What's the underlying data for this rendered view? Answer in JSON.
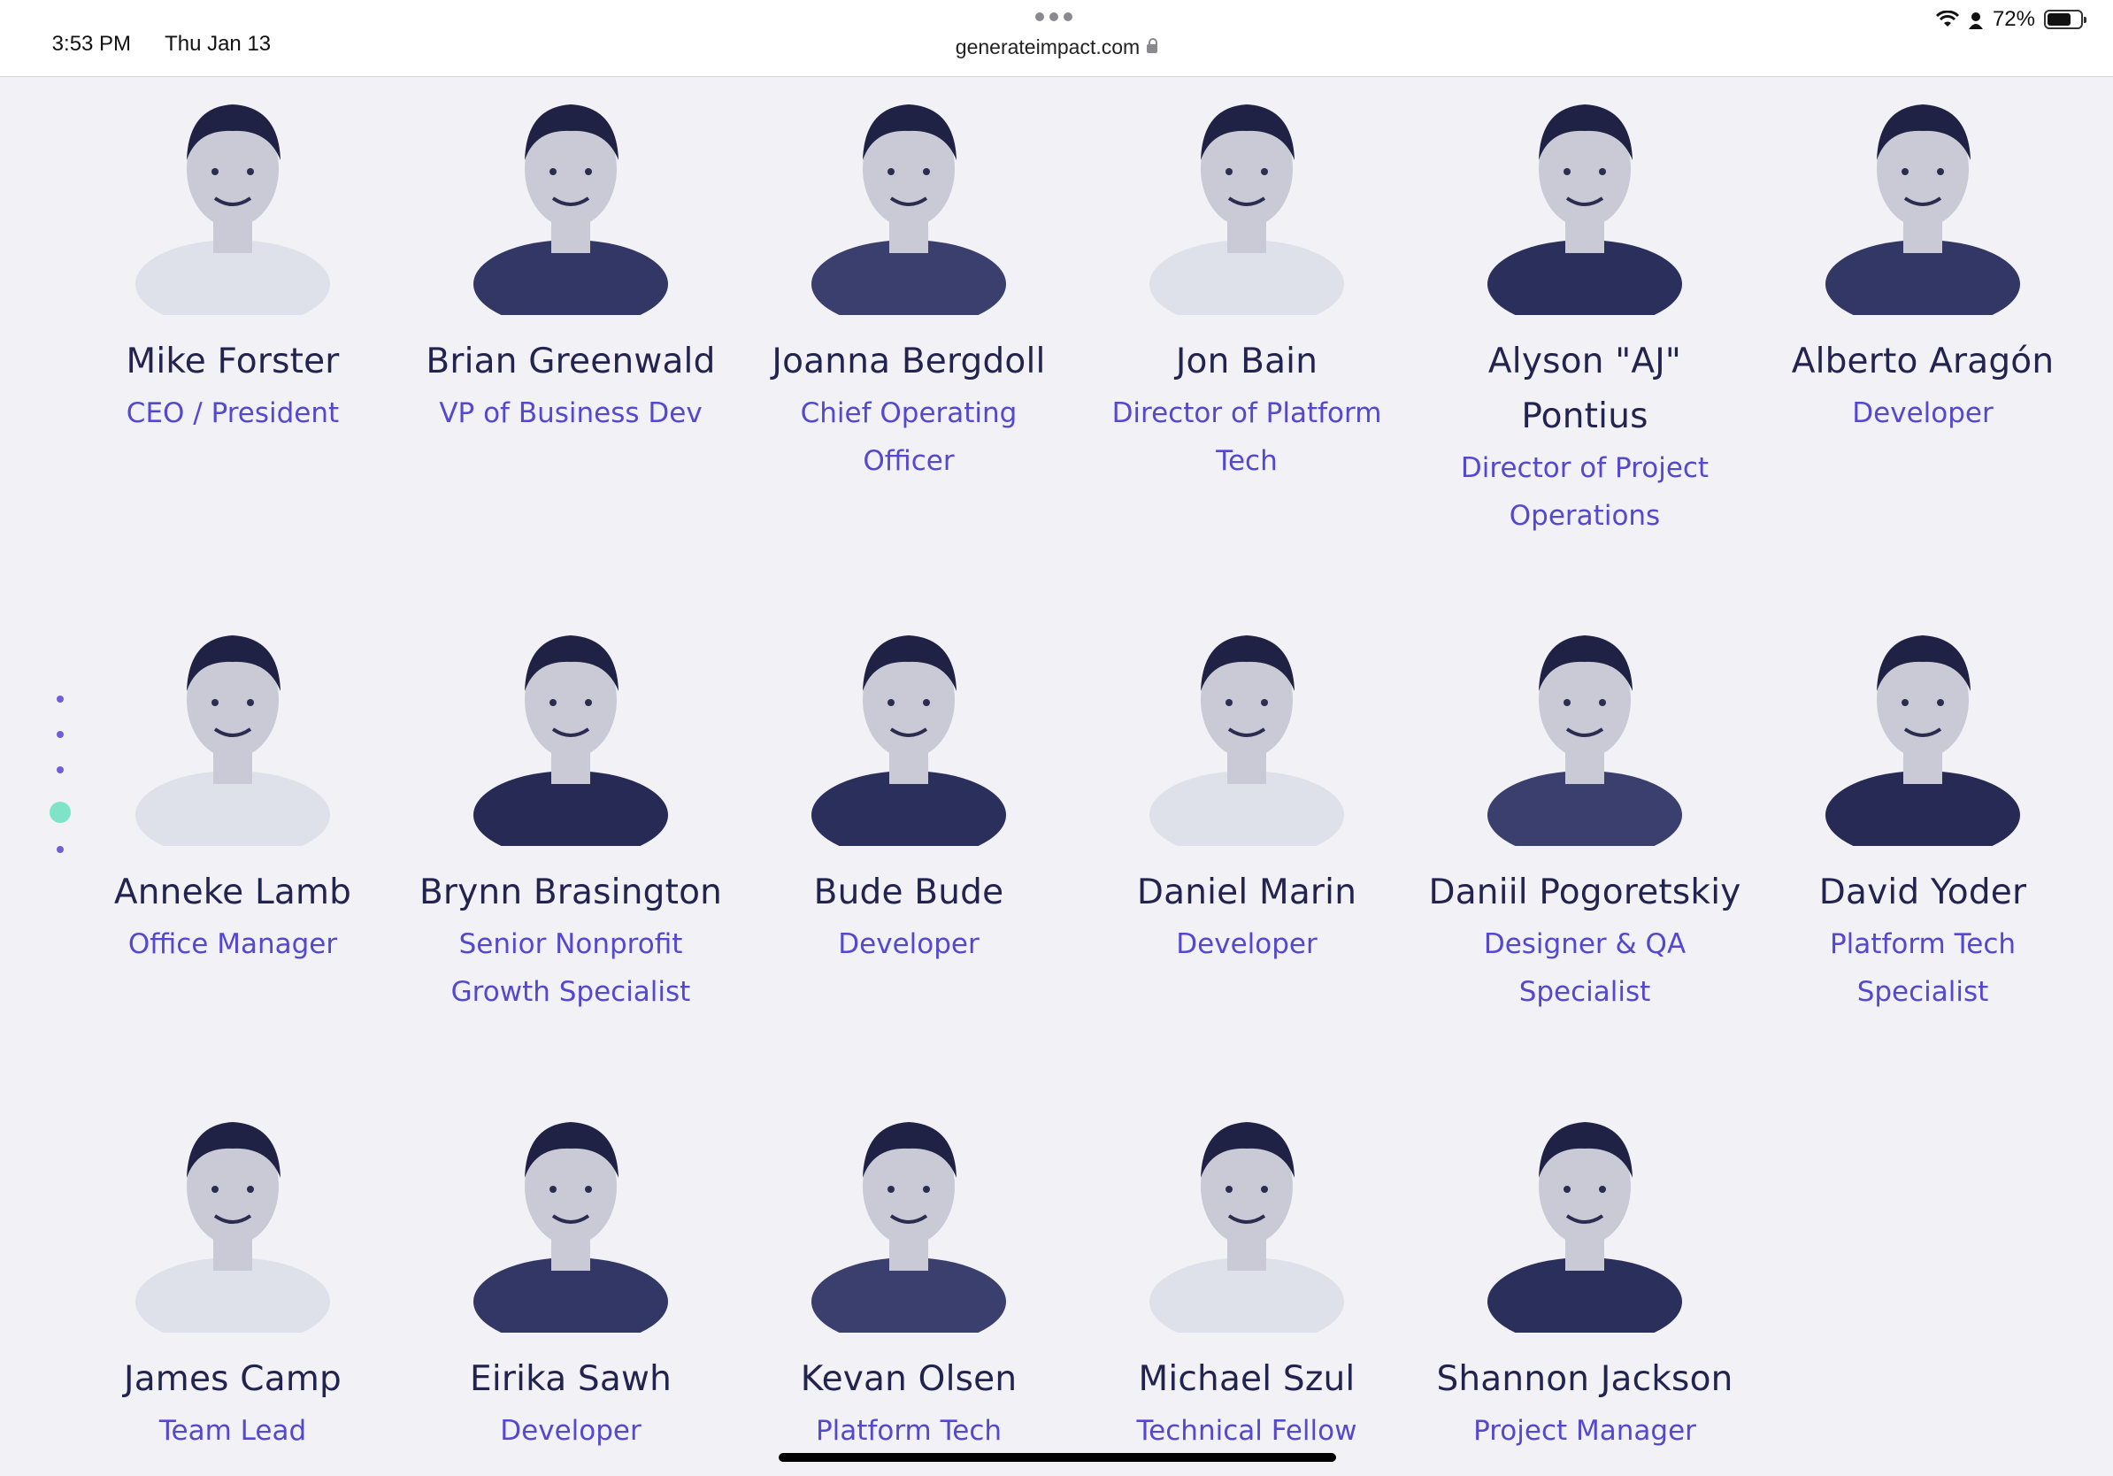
{
  "status_bar": {
    "time": "3:53 PM",
    "date": "Thu Jan 13",
    "battery": "72%",
    "battery_level": 0.72
  },
  "browser": {
    "url": "generateimpact.com"
  },
  "colors": {
    "name": "#232350",
    "role": "#5348cf",
    "pager_active": "#7fe3c7",
    "pager_dot": "#6d5fd8"
  },
  "team": [
    {
      "name": "Mike Forster",
      "role": "CEO / President",
      "icon": "person-photo"
    },
    {
      "name": "Brian Greenwald",
      "role": "VP of Business Dev",
      "icon": "person-photo"
    },
    {
      "name": "Joanna Bergdoll",
      "role": "Chief Operating Officer",
      "icon": "person-photo"
    },
    {
      "name": "Jon Bain",
      "role": "Director of Platform Tech",
      "icon": "person-photo"
    },
    {
      "name": "Alyson \"AJ\" Pontius",
      "role": "Director of Project Operations",
      "icon": "person-photo"
    },
    {
      "name": "Alberto Aragón",
      "role": "Developer",
      "icon": "person-photo"
    },
    {
      "name": "Anneke Lamb",
      "role": "Office Manager",
      "icon": "person-photo"
    },
    {
      "name": "Brynn Brasington",
      "role": "Senior Nonprofit Growth Specialist",
      "icon": "person-photo"
    },
    {
      "name": "Bude Bude",
      "role": "Developer",
      "icon": "person-photo"
    },
    {
      "name": "Daniel Marin",
      "role": "Developer",
      "icon": "person-photo"
    },
    {
      "name": "Daniil Pogoretskiy",
      "role": "Designer & QA Specialist",
      "icon": "person-photo"
    },
    {
      "name": "David Yoder",
      "role": "Platform Tech Specialist",
      "icon": "person-photo"
    },
    {
      "name": "James Camp",
      "role": "Team Lead",
      "icon": "person-photo"
    },
    {
      "name": "Eirika Sawh",
      "role": "Developer",
      "icon": "person-photo"
    },
    {
      "name": "Kevan Olsen",
      "role": "Platform Tech",
      "icon": "person-photo"
    },
    {
      "name": "Michael Szul",
      "role": "Technical Fellow",
      "icon": "person-photo"
    },
    {
      "name": "Shannon Jackson",
      "role": "Project Manager",
      "icon": "person-photo"
    }
  ]
}
